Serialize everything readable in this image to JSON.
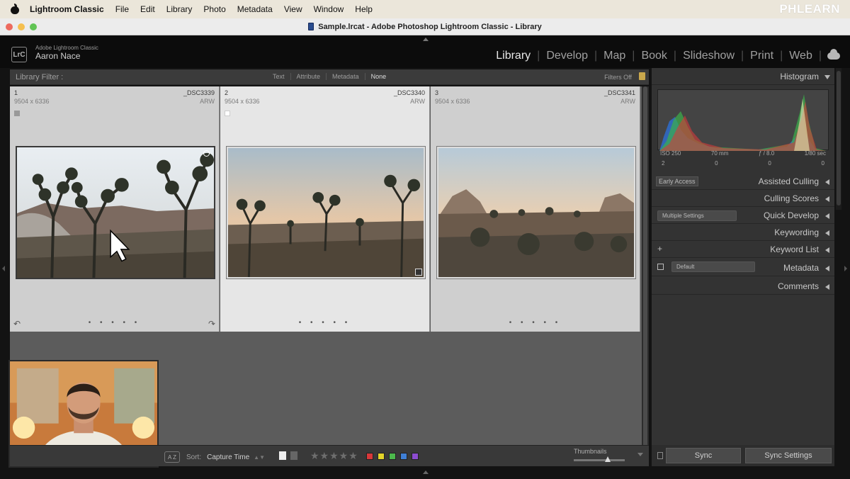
{
  "menubar": {
    "app": "Lightroom Classic",
    "items": [
      "File",
      "Edit",
      "Library",
      "Photo",
      "Metadata",
      "View",
      "Window",
      "Help"
    ],
    "watermark": "PHLEARN"
  },
  "window": {
    "title": "Sample.lrcat - Adobe Photoshop Lightroom Classic - Library",
    "lights": [
      "#ed6a5e",
      "#f5bf4f",
      "#61c454"
    ]
  },
  "identity": {
    "logo": "LrC",
    "product": "Adobe Lightroom Classic",
    "user": "Aaron Nace"
  },
  "modules": {
    "items": [
      "Library",
      "Develop",
      "Map",
      "Book",
      "Slideshow",
      "Print",
      "Web"
    ],
    "active": "Library"
  },
  "filterbar": {
    "label": "Library Filter :",
    "options": [
      "Text",
      "Attribute",
      "Metadata",
      "None"
    ],
    "status": "Filters Off"
  },
  "photos": [
    {
      "index": "1",
      "dims": "9504 x 6336",
      "name": "_DSC3339",
      "ext": "ARW",
      "dots": "• • • • •"
    },
    {
      "index": "2",
      "dims": "9504 x 6336",
      "name": "_DSC3340",
      "ext": "ARW",
      "dots": "• • • • •"
    },
    {
      "index": "3",
      "dims": "9504 x 6336",
      "name": "_DSC3341",
      "ext": "ARW",
      "dots": "• • • • •"
    }
  ],
  "toolbar": {
    "sort_label": "Sort:",
    "sort_value": "Capture Time",
    "az_icon": "A Z",
    "stars": "★★★★★",
    "label_colors": [
      "#d9383a",
      "#e4d52a",
      "#4cb84c",
      "#3f7fd6",
      "#8c4cd0"
    ],
    "thumbnails_label": "Thumbnails",
    "thumb_size": 0.67
  },
  "histogram": {
    "title": "Histogram",
    "iso": "ISO 250",
    "focal": "70 mm",
    "aperture": "ƒ / 8.0",
    "shutter": "1/80 sec",
    "counts": [
      "2",
      "0",
      "0",
      "0"
    ]
  },
  "panels": {
    "early_access": "Early Access",
    "assisted_culling": "Assisted Culling",
    "culling_scores": "Culling Scores",
    "quick_develop": "Quick Develop",
    "quick_develop_select": "Multiple Settings",
    "keywording": "Keywording",
    "keyword_list": "Keyword List",
    "keyword_plus": "+",
    "metadata": "Metadata",
    "metadata_select": "Default",
    "comments": "Comments"
  },
  "sync": {
    "sync": "Sync",
    "sync_settings": "Sync Settings"
  }
}
